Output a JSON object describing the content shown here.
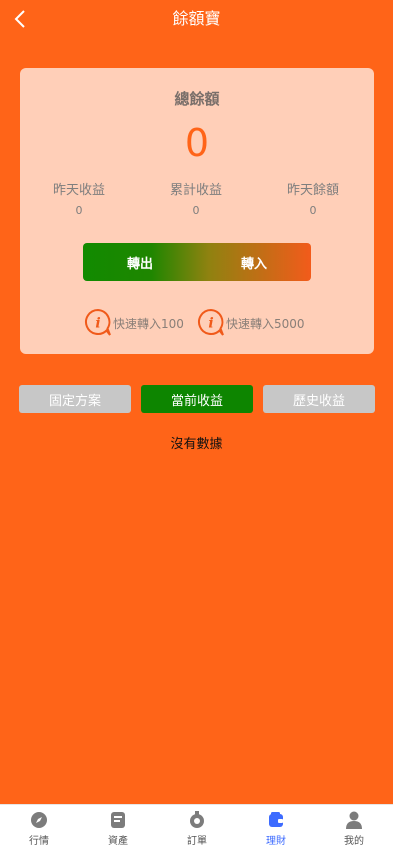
{
  "header": {
    "title": "餘額寶",
    "back_icon": "chevron-left-icon"
  },
  "summary": {
    "total_label": "總餘額",
    "total_value": "0",
    "stats": [
      {
        "label": "昨天收益",
        "value": "0"
      },
      {
        "label": "累計收益",
        "value": "0"
      },
      {
        "label": "昨天餘額",
        "value": "0"
      }
    ]
  },
  "transfer": {
    "out_label": "轉出",
    "in_label": "轉入"
  },
  "quick": [
    {
      "label": "快速轉入100",
      "icon": "info-icon"
    },
    {
      "label": "快速轉入5000",
      "icon": "info-icon"
    }
  ],
  "tabs": [
    {
      "label": "固定方案",
      "active": false
    },
    {
      "label": "當前收益",
      "active": true
    },
    {
      "label": "歷史收益",
      "active": false
    }
  ],
  "empty_text": "沒有數據",
  "nav": [
    {
      "label": "行情",
      "icon": "compass-icon",
      "active": false
    },
    {
      "label": "資產",
      "icon": "wallet-doc-icon",
      "active": false
    },
    {
      "label": "訂單",
      "icon": "order-icon",
      "active": false
    },
    {
      "label": "理財",
      "icon": "finance-icon",
      "active": true
    },
    {
      "label": "我的",
      "icon": "user-icon",
      "active": false
    }
  ],
  "colors": {
    "background": "#ff6418",
    "card": "#ffcfb8",
    "accent_green": "#0d8500",
    "nav_active": "#3d6bff"
  }
}
